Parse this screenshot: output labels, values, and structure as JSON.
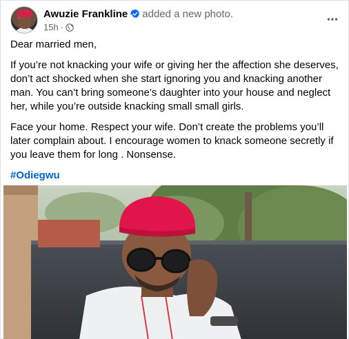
{
  "post": {
    "author": "Awuzie Frankline",
    "action": "added a new photo.",
    "time": "15h",
    "separator": "·",
    "audience_icon": "globe-icon",
    "verified_icon": "verified-badge-icon",
    "more_icon": "more-options-icon",
    "paragraphs": [
      "Dear married men,",
      "If you’re not knacking your wife or giving her the affection she deserves, don’t act shocked when she start ignoring you and knacking another man. You can’t bring someone’s daughter into your house and neglect her, while you’re outside knacking small small girls.",
      "Face your home. Respect your wife. Don’t create the problems you’ll later complain about. I encourage women to knack someone secretly if you leave them for long .  Nonsense."
    ],
    "hashtag": "#Odiegwu"
  },
  "colors": {
    "verified": "#0866ff",
    "hashtag": "#0064d1",
    "secondary_text": "#65676b"
  }
}
